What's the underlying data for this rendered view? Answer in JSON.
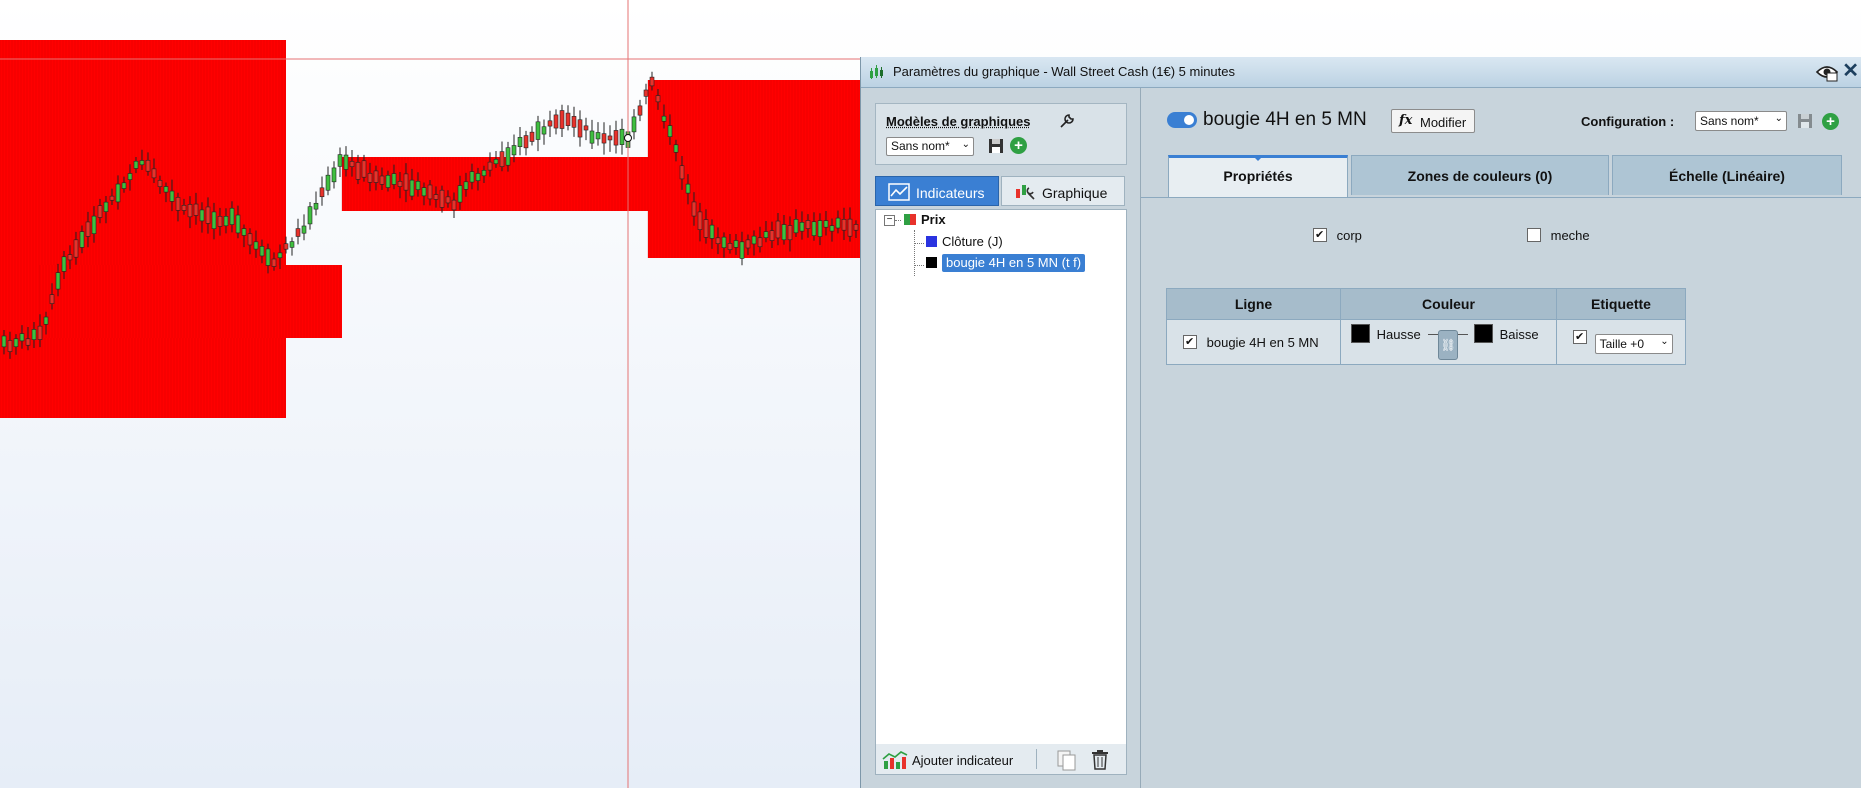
{
  "dialog": {
    "title": "Paramètres du graphique - Wall Street Cash (1€) 5 minutes",
    "close_glyph": "✕"
  },
  "models": {
    "title": "Modèles de graphiques",
    "selected": "Sans nom*",
    "plus_glyph": "+"
  },
  "left_tabs": {
    "indicators": "Indicateurs",
    "chart": "Graphique"
  },
  "tree": {
    "toggle_glyph": "−",
    "root": "Prix",
    "root_colors": [
      "#2fa043",
      "#e8322b"
    ],
    "items": [
      {
        "label": "Clôture (J)",
        "color": "#2a33e0"
      },
      {
        "label": "bougie 4H en 5 MN (t f)",
        "color": "#000000",
        "selected": true
      }
    ]
  },
  "bottom": {
    "add_indicator": "Ajouter indicateur"
  },
  "indicator": {
    "name": "bougie 4H en 5 MN",
    "modify": "Modifier",
    "fx": "fx",
    "enabled": true
  },
  "configuration": {
    "label": "Configuration :",
    "selected": "Sans nom*",
    "plus_glyph": "+"
  },
  "prop_tabs": {
    "properties": "Propriétés",
    "color_zones": "Zones de couleurs (0)",
    "scale": "Échelle (Linéaire)"
  },
  "options": {
    "body": {
      "label": "corp",
      "checked": true
    },
    "wick": {
      "label": "meche",
      "checked": false
    }
  },
  "table": {
    "headers": [
      "Ligne",
      "Couleur",
      "Etiquette"
    ],
    "row": {
      "line_label": "bougie 4H en 5 MN",
      "line_checked": true,
      "up_label": "Hausse",
      "up_color": "#000000",
      "down_label": "Baisse",
      "down_color": "#000000",
      "label_checked": true,
      "size": "Taille +0"
    }
  },
  "chart_colors": {
    "zone": "#ff0000",
    "bull": "#3fbf3f",
    "bear": "#e8322b",
    "crosshair": "#e57373"
  }
}
